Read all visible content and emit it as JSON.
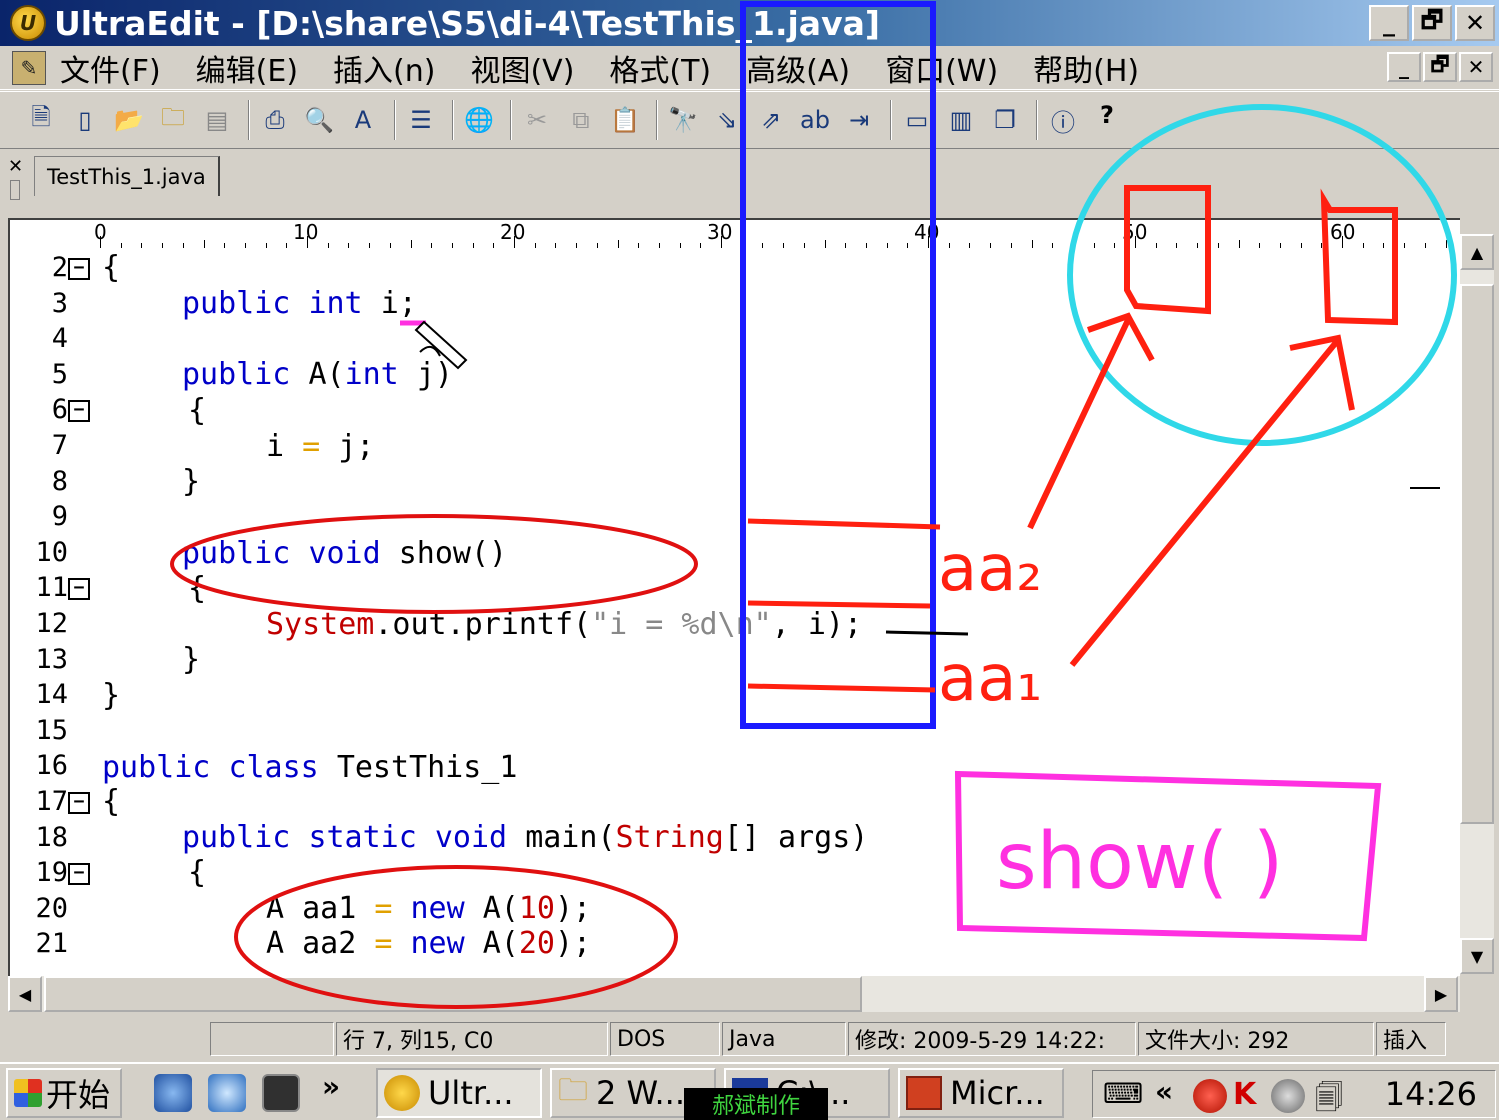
{
  "window": {
    "title": "UltraEdit - [D:\\share\\S5\\di-4\\TestThis_1.java]",
    "app_icon": "ultraedit-icon",
    "controls": [
      "_",
      "🗗",
      "✕"
    ]
  },
  "menu": {
    "items": [
      "文件(F)",
      "编辑(E)",
      "插入(n)",
      "视图(V)",
      "格式(T)",
      "高级(A)",
      "窗口(W)",
      "帮助(H)"
    ],
    "mdi_controls": [
      "_",
      "🗗",
      "✕"
    ]
  },
  "toolbar": {
    "icons": [
      "new-icon",
      "new-file-icon",
      "open-icon",
      "open-folder-icon",
      "save-icon",
      "print-icon",
      "print-preview-icon",
      "spell-icon",
      "wrap-icon",
      "web-icon",
      "cut-icon",
      "copy-icon",
      "paste-icon",
      "find-icon",
      "find-next-icon",
      "find-prev-icon",
      "replace-icon",
      "goto-icon",
      "tile-horizontal-icon",
      "tile-vertical-icon",
      "cascade-icon",
      "info-icon",
      "help-icon"
    ],
    "help_label": "?"
  },
  "tabs": [
    {
      "label": "TestThis_1.java"
    }
  ],
  "ruler": {
    "labels": [
      "0",
      "10",
      "20",
      "30",
      "40",
      "50",
      "60"
    ]
  },
  "editor": {
    "lines": [
      {
        "num": "2",
        "fold": true
      },
      {
        "num": "3",
        "fold": false
      },
      {
        "num": "4",
        "fold": false
      },
      {
        "num": "5",
        "fold": false
      },
      {
        "num": "6",
        "fold": true
      },
      {
        "num": "7",
        "fold": false
      },
      {
        "num": "8",
        "fold": false
      },
      {
        "num": "9",
        "fold": false
      },
      {
        "num": "10",
        "fold": false
      },
      {
        "num": "11",
        "fold": true
      },
      {
        "num": "12",
        "fold": false
      },
      {
        "num": "13",
        "fold": false
      },
      {
        "num": "14",
        "fold": false
      },
      {
        "num": "15",
        "fold": false
      },
      {
        "num": "16",
        "fold": false
      },
      {
        "num": "17",
        "fold": true
      },
      {
        "num": "18",
        "fold": false
      },
      {
        "num": "19",
        "fold": true
      },
      {
        "num": "20",
        "fold": false
      },
      {
        "num": "21",
        "fold": false
      }
    ],
    "code": {
      "l2_brace": "{",
      "l3_public": "public",
      "l3_int": "int",
      "l3_rest": "i;",
      "l5_public": "public",
      "l5_a": "A(",
      "l5_int": "int",
      "l5_rest": "j)",
      "l6_brace": "{",
      "l7_i": "i",
      "l7_eq": "=",
      "l7_rest": "j;",
      "l8_brace": "}",
      "l10_public": "public",
      "l10_void": "void",
      "l10_rest": "show()",
      "l11_brace": "{",
      "l12_system": "System",
      "l12_mid": ".out.printf(",
      "l12_str": "\"i = %d\\n\"",
      "l12_rest": ", i);",
      "l13_brace": "}",
      "l14_brace": "}",
      "l16_public": "public",
      "l16_class": "class",
      "l16_rest": "TestThis_1",
      "l17_brace": "{",
      "l18_public": "public",
      "l18_static": "static",
      "l18_void": "void",
      "l18_main": "main(",
      "l18_string": "String",
      "l18_rest": "[] args)",
      "l19_brace": "{",
      "l20_decl": "A aa1",
      "l20_eq": "=",
      "l20_new": "new",
      "l20_a": "A(",
      "l20_num": "10",
      "l20_end": ");",
      "l21_decl": "A aa2",
      "l21_eq": "=",
      "l21_new": "new",
      "l21_a": "A(",
      "l21_num": "20",
      "l21_end": ");"
    }
  },
  "annotations": {
    "label_aa2": "aa₂",
    "label_aa1": "aa₁",
    "show_box_text": "show( )"
  },
  "statusbar": {
    "position": "行 7, 列15, C0",
    "line_ending": "DOS",
    "language": "Java",
    "modified": "修改:  2009-5-29 14:22:",
    "file_size": "文件大小:  292",
    "mode": "插入"
  },
  "taskbar": {
    "start_label": "开始",
    "tasks": [
      {
        "label": "Ultr...",
        "icon": "ultraedit-icon",
        "active": true
      },
      {
        "label": "2 W...",
        "icon": "folder-icon",
        "active": false
      },
      {
        "label": "C:\\...",
        "icon": "console-icon",
        "active": false
      },
      {
        "label": "Micr...",
        "icon": "powerpoint-icon",
        "active": false
      }
    ],
    "clock": "14:26",
    "chevron": "»",
    "tray_chevron": "«",
    "watermark": "郝斌制作"
  },
  "colors": {
    "keyword": "#0000c8",
    "type": "#c00000",
    "number": "#c00000",
    "operator": "#e0a000",
    "string": "#888888",
    "annotation_red": "#ff2010",
    "annotation_blue": "#1a1aff",
    "annotation_cyan": "#30d8e8",
    "annotation_magenta": "#ff30e0"
  }
}
